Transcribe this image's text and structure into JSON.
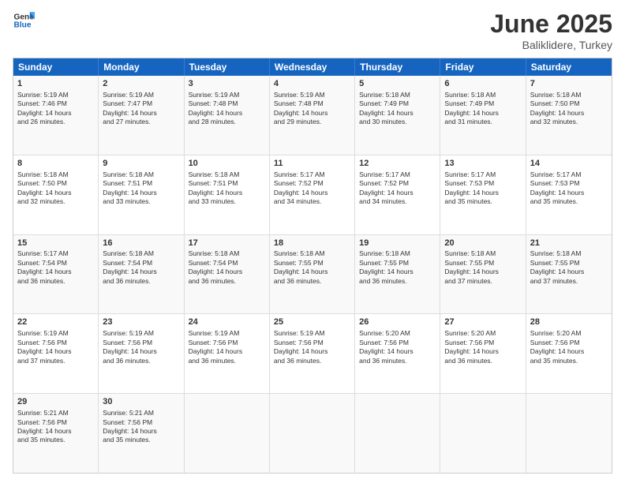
{
  "logo": {
    "general": "General",
    "blue": "Blue"
  },
  "title": {
    "month": "June 2025",
    "location": "Baliklidere, Turkey"
  },
  "header_days": [
    "Sunday",
    "Monday",
    "Tuesday",
    "Wednesday",
    "Thursday",
    "Friday",
    "Saturday"
  ],
  "weeks": [
    [
      {
        "day": "1",
        "lines": [
          "Sunrise: 5:19 AM",
          "Sunset: 7:46 PM",
          "Daylight: 14 hours",
          "and 26 minutes."
        ]
      },
      {
        "day": "2",
        "lines": [
          "Sunrise: 5:19 AM",
          "Sunset: 7:47 PM",
          "Daylight: 14 hours",
          "and 27 minutes."
        ]
      },
      {
        "day": "3",
        "lines": [
          "Sunrise: 5:19 AM",
          "Sunset: 7:48 PM",
          "Daylight: 14 hours",
          "and 28 minutes."
        ]
      },
      {
        "day": "4",
        "lines": [
          "Sunrise: 5:19 AM",
          "Sunset: 7:48 PM",
          "Daylight: 14 hours",
          "and 29 minutes."
        ]
      },
      {
        "day": "5",
        "lines": [
          "Sunrise: 5:18 AM",
          "Sunset: 7:49 PM",
          "Daylight: 14 hours",
          "and 30 minutes."
        ]
      },
      {
        "day": "6",
        "lines": [
          "Sunrise: 5:18 AM",
          "Sunset: 7:49 PM",
          "Daylight: 14 hours",
          "and 31 minutes."
        ]
      },
      {
        "day": "7",
        "lines": [
          "Sunrise: 5:18 AM",
          "Sunset: 7:50 PM",
          "Daylight: 14 hours",
          "and 32 minutes."
        ]
      }
    ],
    [
      {
        "day": "8",
        "lines": [
          "Sunrise: 5:18 AM",
          "Sunset: 7:50 PM",
          "Daylight: 14 hours",
          "and 32 minutes."
        ]
      },
      {
        "day": "9",
        "lines": [
          "Sunrise: 5:18 AM",
          "Sunset: 7:51 PM",
          "Daylight: 14 hours",
          "and 33 minutes."
        ]
      },
      {
        "day": "10",
        "lines": [
          "Sunrise: 5:18 AM",
          "Sunset: 7:51 PM",
          "Daylight: 14 hours",
          "and 33 minutes."
        ]
      },
      {
        "day": "11",
        "lines": [
          "Sunrise: 5:17 AM",
          "Sunset: 7:52 PM",
          "Daylight: 14 hours",
          "and 34 minutes."
        ]
      },
      {
        "day": "12",
        "lines": [
          "Sunrise: 5:17 AM",
          "Sunset: 7:52 PM",
          "Daylight: 14 hours",
          "and 34 minutes."
        ]
      },
      {
        "day": "13",
        "lines": [
          "Sunrise: 5:17 AM",
          "Sunset: 7:53 PM",
          "Daylight: 14 hours",
          "and 35 minutes."
        ]
      },
      {
        "day": "14",
        "lines": [
          "Sunrise: 5:17 AM",
          "Sunset: 7:53 PM",
          "Daylight: 14 hours",
          "and 35 minutes."
        ]
      }
    ],
    [
      {
        "day": "15",
        "lines": [
          "Sunrise: 5:17 AM",
          "Sunset: 7:54 PM",
          "Daylight: 14 hours",
          "and 36 minutes."
        ]
      },
      {
        "day": "16",
        "lines": [
          "Sunrise: 5:18 AM",
          "Sunset: 7:54 PM",
          "Daylight: 14 hours",
          "and 36 minutes."
        ]
      },
      {
        "day": "17",
        "lines": [
          "Sunrise: 5:18 AM",
          "Sunset: 7:54 PM",
          "Daylight: 14 hours",
          "and 36 minutes."
        ]
      },
      {
        "day": "18",
        "lines": [
          "Sunrise: 5:18 AM",
          "Sunset: 7:55 PM",
          "Daylight: 14 hours",
          "and 36 minutes."
        ]
      },
      {
        "day": "19",
        "lines": [
          "Sunrise: 5:18 AM",
          "Sunset: 7:55 PM",
          "Daylight: 14 hours",
          "and 36 minutes."
        ]
      },
      {
        "day": "20",
        "lines": [
          "Sunrise: 5:18 AM",
          "Sunset: 7:55 PM",
          "Daylight: 14 hours",
          "and 37 minutes."
        ]
      },
      {
        "day": "21",
        "lines": [
          "Sunrise: 5:18 AM",
          "Sunset: 7:55 PM",
          "Daylight: 14 hours",
          "and 37 minutes."
        ]
      }
    ],
    [
      {
        "day": "22",
        "lines": [
          "Sunrise: 5:19 AM",
          "Sunset: 7:56 PM",
          "Daylight: 14 hours",
          "and 37 minutes."
        ]
      },
      {
        "day": "23",
        "lines": [
          "Sunrise: 5:19 AM",
          "Sunset: 7:56 PM",
          "Daylight: 14 hours",
          "and 36 minutes."
        ]
      },
      {
        "day": "24",
        "lines": [
          "Sunrise: 5:19 AM",
          "Sunset: 7:56 PM",
          "Daylight: 14 hours",
          "and 36 minutes."
        ]
      },
      {
        "day": "25",
        "lines": [
          "Sunrise: 5:19 AM",
          "Sunset: 7:56 PM",
          "Daylight: 14 hours",
          "and 36 minutes."
        ]
      },
      {
        "day": "26",
        "lines": [
          "Sunrise: 5:20 AM",
          "Sunset: 7:56 PM",
          "Daylight: 14 hours",
          "and 36 minutes."
        ]
      },
      {
        "day": "27",
        "lines": [
          "Sunrise: 5:20 AM",
          "Sunset: 7:56 PM",
          "Daylight: 14 hours",
          "and 36 minutes."
        ]
      },
      {
        "day": "28",
        "lines": [
          "Sunrise: 5:20 AM",
          "Sunset: 7:56 PM",
          "Daylight: 14 hours",
          "and 35 minutes."
        ]
      }
    ],
    [
      {
        "day": "29",
        "lines": [
          "Sunrise: 5:21 AM",
          "Sunset: 7:56 PM",
          "Daylight: 14 hours",
          "and 35 minutes."
        ]
      },
      {
        "day": "30",
        "lines": [
          "Sunrise: 5:21 AM",
          "Sunset: 7:56 PM",
          "Daylight: 14 hours",
          "and 35 minutes."
        ]
      },
      {
        "day": "",
        "lines": []
      },
      {
        "day": "",
        "lines": []
      },
      {
        "day": "",
        "lines": []
      },
      {
        "day": "",
        "lines": []
      },
      {
        "day": "",
        "lines": []
      }
    ]
  ]
}
